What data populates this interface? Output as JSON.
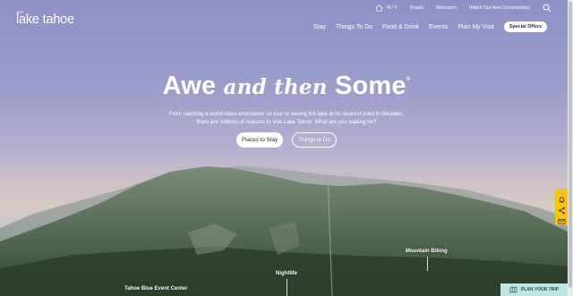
{
  "logo": {
    "prefix": "visit",
    "name": "lake tahoe"
  },
  "utility": {
    "temperature": "41° F",
    "links": [
      "Roads",
      "Webcams",
      "Watch Our Awe Documentary"
    ]
  },
  "nav": {
    "items": [
      "Stay",
      "Things To Do",
      "Food & Drink",
      "Events",
      "Plan My Visit"
    ],
    "special_label": "Special Offers"
  },
  "hero": {
    "title_a": "Awe",
    "title_b": "and then",
    "title_c": "Some",
    "title_reg": "®",
    "subtitle_line1": "From catching a world-class entertainer on tour to seeing the lake at its clearest point in decades,",
    "subtitle_line2": "there are millions of reasons to visit Lake Tahoe. What are you waiting for?",
    "btn_primary": "Places to Stay",
    "btn_secondary": "Things to Do"
  },
  "map_labels": {
    "mountain": "Mountain Biking",
    "night": "Nightlife",
    "event": "Tahoe Blue Event Center"
  },
  "plan_trip": {
    "label": "PLAN YOUR TRIP"
  },
  "colors": {
    "rail": "#f1c419",
    "plan": "#bfe6e0",
    "sky": "#8e8fc4"
  }
}
